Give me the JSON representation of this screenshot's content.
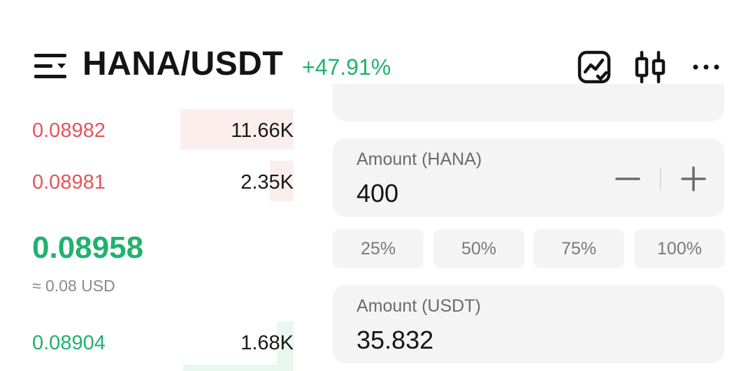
{
  "header": {
    "pair": "HANA/USDT",
    "change": "+47.91%",
    "icons": [
      "menu-icon",
      "chart-icon",
      "candlestick-icon",
      "more-icon"
    ]
  },
  "orderbook": {
    "asks": [
      {
        "price": "0.08982",
        "qty": "11.66K",
        "depth": 0.4
      },
      {
        "price": "0.08981",
        "qty": "2.35K",
        "depth": 0.08
      }
    ],
    "last_price": "0.08958",
    "last_price_usd": "≈ 0.08 USD",
    "bids": [
      {
        "price": "0.08904",
        "qty": "1.68K",
        "depth": 0.06
      }
    ]
  },
  "form": {
    "amount": {
      "label": "Amount (HANA)",
      "value": "400"
    },
    "percentages": [
      "25%",
      "50%",
      "75%",
      "100%"
    ],
    "total": {
      "label": "Amount (USDT)",
      "value": "35.832"
    }
  },
  "colors": {
    "up": "#20b26c",
    "down": "#e5555a",
    "field_bg": "#f4f4f4"
  }
}
